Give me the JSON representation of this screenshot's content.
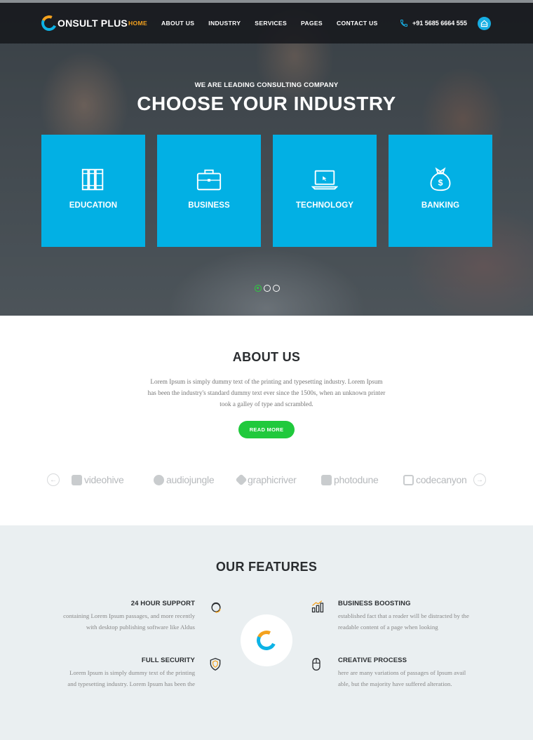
{
  "header": {
    "logo_text": "ONSULT PLUS",
    "nav": [
      "HOME",
      "ABOUT US",
      "INDUSTRY",
      "SERVICES",
      "PAGES",
      "CONTACT US"
    ],
    "active_nav": "HOME",
    "phone": "+91 5685 6664 555"
  },
  "hero": {
    "kicker": "WE ARE LEADING CONSULTING COMPANY",
    "title": "CHOOSE YOUR INDUSTRY",
    "cards": [
      {
        "label": "EDUCATION",
        "icon": "books-icon"
      },
      {
        "label": "BUSINESS",
        "icon": "briefcase-icon"
      },
      {
        "label": "TECHNOLOGY",
        "icon": "laptop-icon"
      },
      {
        "label": "BANKING",
        "icon": "money-bag-icon"
      }
    ],
    "slide_count": 3,
    "active_slide": 1
  },
  "about": {
    "title": "ABOUT US",
    "text_lines": [
      "Lorem Ipsum is simply dummy text of the printing and typesetting industry. Lorem Ipsum",
      "has been the industry's standard dummy text ever since the 1500s, when an unknown printer",
      "took a galley of type and scrambled."
    ],
    "button": "READ MORE",
    "brands": [
      "videohive",
      "audiojungle",
      "graphicriver",
      "photodune",
      "codecanyon"
    ]
  },
  "features": {
    "title": "OUR FEATURES",
    "items": [
      {
        "title": "24 HOUR SUPPORT",
        "lines": [
          "containing Lorem Ipsum passages, and more recently",
          "with desktop publishing software like Aldus"
        ],
        "icon": "support-agent-icon"
      },
      {
        "title": "BUSINESS BOOSTING",
        "lines": [
          "established fact that a reader will be distracted by the",
          "readable content of a page when looking"
        ],
        "icon": "growth-chart-icon"
      },
      {
        "title": "FULL SECURITY",
        "lines": [
          "Lorem Ipsum is simply dummy text of the printing",
          "and typesetting industry. Lorem Ipsum has been the"
        ],
        "icon": "shield-icon"
      },
      {
        "title": "CREATIVE PROCESS",
        "lines": [
          "here are many variations of passages of Ipsum avail",
          "able, but the majority have suffered alteration."
        ],
        "icon": "mouse-icon"
      }
    ]
  },
  "colors": {
    "accent_blue": "#02b0e4",
    "accent_orange": "#f4a21e",
    "accent_green": "#20c93c"
  }
}
